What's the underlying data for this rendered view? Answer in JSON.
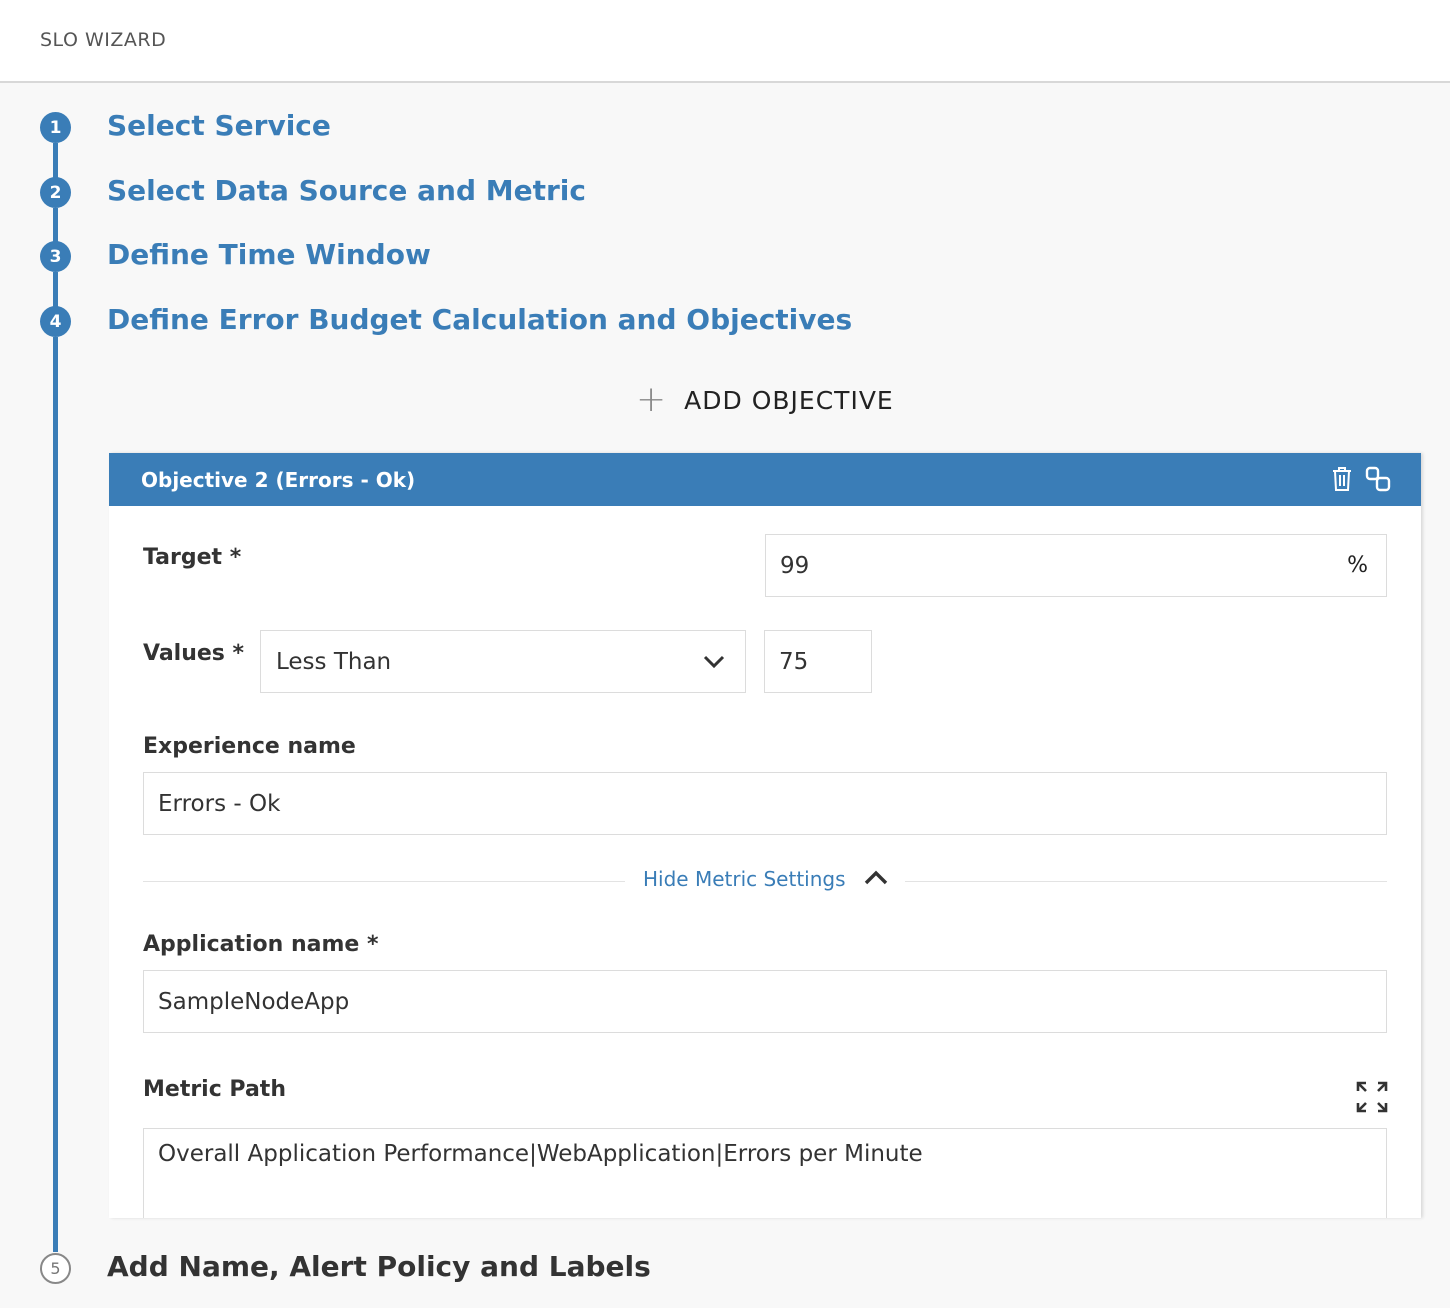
{
  "header": {
    "title": "SLO WIZARD"
  },
  "steps": [
    {
      "number": "1",
      "title": "Select Service"
    },
    {
      "number": "2",
      "title": "Select Data Source and Metric"
    },
    {
      "number": "3",
      "title": "Define Time Window"
    },
    {
      "number": "4",
      "title": "Define Error Budget Calculation and Objectives"
    },
    {
      "number": "5",
      "title": "Add Name, Alert Policy and Labels"
    }
  ],
  "add_objective": {
    "icon": "plus-icon",
    "label": "ADD OBJECTIVE"
  },
  "objective": {
    "title": "Objective 2 (Errors - Ok)",
    "actions": [
      {
        "icon": "trash-icon"
      },
      {
        "icon": "copy-icon"
      }
    ],
    "target": {
      "label": "Target *",
      "value": "99",
      "suffix": "%"
    },
    "values": {
      "label": "Values *",
      "operator": "Less Than",
      "threshold": "75"
    },
    "experience": {
      "label": "Experience name",
      "value": "Errors - Ok"
    },
    "metric_toggle": {
      "label": "Hide Metric Settings"
    },
    "application": {
      "label": "Application name  *",
      "value": "SampleNodeApp"
    },
    "metric_path": {
      "label": "Metric Path",
      "value": "Overall Application Performance|WebApplication|Errors per Minute"
    }
  },
  "colors": {
    "accent": "#3a7db7",
    "background": "#f8f8f8",
    "text": "#333333"
  }
}
